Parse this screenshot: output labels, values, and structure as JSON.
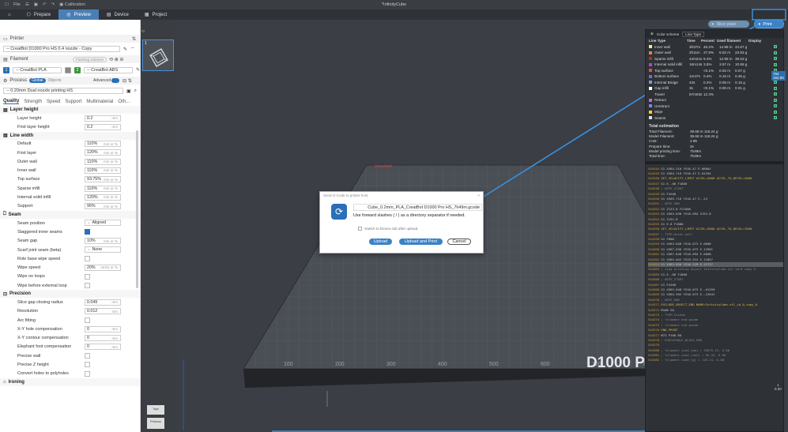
{
  "titlebar": {
    "items": [
      "File"
    ],
    "title": "*InfinityCube"
  },
  "tabs": [
    {
      "label": "Prepare",
      "active": false
    },
    {
      "label": "Preview",
      "active": true
    },
    {
      "label": "Device",
      "active": false
    },
    {
      "label": "Project",
      "active": false
    }
  ],
  "topright": {
    "slice_plate": "Slice plate",
    "print": "Print"
  },
  "sidebar": {
    "printer_header": "Printer",
    "printer_value": "-- CreatBot D1000 Pro HS 0.4 nozzle - Copy",
    "filament_header": "Filament",
    "flushing_label": "Flushing volumes",
    "filament_1": "-- CreatBot PLA",
    "filament_2": "-- CreatBot ABS",
    "process_header": "Process",
    "process_global": "Global",
    "process_objects": "Objects",
    "advanced_label": "Advanced",
    "process_value": "-- 0.20mm Dual nozzle printing HS",
    "quality_tabs": [
      "Quality",
      "Strength",
      "Speed",
      "Support",
      "Multimaterial",
      "Oth..."
    ],
    "groups": {
      "layer_height": "Layer height",
      "line_width": "Line width",
      "seam": "Seam",
      "precision": "Precision",
      "ironing": "Ironing"
    },
    "layer_height": [
      {
        "label": "Layer height",
        "value": "0.2",
        "unit": "mm"
      },
      {
        "label": "First layer height",
        "value": "0.2",
        "unit": "mm"
      }
    ],
    "line_width": [
      {
        "label": "Default",
        "value": "110%",
        "unit": "mm or %"
      },
      {
        "label": "First layer",
        "value": "120%",
        "unit": "mm or %"
      },
      {
        "label": "Outer wall",
        "value": "110%",
        "unit": "mm or %"
      },
      {
        "label": "Inner wall",
        "value": "110%",
        "unit": "mm or %"
      },
      {
        "label": "Top surface",
        "value": "93.75%",
        "unit": "mm or %"
      },
      {
        "label": "Sparse infill",
        "value": "110%",
        "unit": "mm or %"
      },
      {
        "label": "Internal solid infill",
        "value": "120%",
        "unit": "mm or %"
      },
      {
        "label": "Support",
        "value": "96%",
        "unit": "mm or %"
      }
    ],
    "seam": [
      {
        "label": "Seam position",
        "value": "Aligned",
        "unit": "",
        "type": "select"
      },
      {
        "label": "Staggered inner seams",
        "value": "",
        "unit": "",
        "type": "check",
        "checked": true
      },
      {
        "label": "Seam gap",
        "value": "10%",
        "unit": "mm or %"
      },
      {
        "label": "Scarf joint seam (beta)",
        "value": "None",
        "unit": "",
        "type": "select"
      },
      {
        "label": "Role base wipe speed",
        "value": "",
        "unit": "",
        "type": "check",
        "checked": false
      },
      {
        "label": "Wipe speed",
        "value": "20%",
        "unit": "mm/s or %"
      },
      {
        "label": "Wipe on loops",
        "value": "",
        "unit": "",
        "type": "check",
        "checked": false
      },
      {
        "label": "Wipe before external loop",
        "value": "",
        "unit": "",
        "type": "check",
        "checked": false
      }
    ],
    "precision": [
      {
        "label": "Slice gap closing radius",
        "value": "0.049",
        "unit": "mm"
      },
      {
        "label": "Resolution",
        "value": "0.012",
        "unit": "mm"
      },
      {
        "label": "Arc fitting",
        "value": "",
        "unit": "",
        "type": "check",
        "checked": false
      },
      {
        "label": "X-Y hole compensation",
        "value": "0",
        "unit": "mm"
      },
      {
        "label": "X-Y contour compensation",
        "value": "0",
        "unit": "mm"
      },
      {
        "label": "Elephant foot compensation",
        "value": "0",
        "unit": "mm"
      },
      {
        "label": "Precise wall",
        "value": "",
        "unit": "",
        "type": "check",
        "checked": false
      },
      {
        "label": "Precise Z height",
        "value": "",
        "unit": "",
        "type": "check",
        "checked": false
      },
      {
        "label": "Convert holes to polyholes",
        "value": "",
        "unit": "",
        "type": "check",
        "checked": false
      }
    ]
  },
  "thumb_index": "1",
  "bed": {
    "brand": "D1000 Pro",
    "ticks": [
      "100",
      "200",
      "300",
      "400",
      "500",
      "600",
      "700",
      "800",
      "900"
    ]
  },
  "legend": {
    "scheme_label": "Color scheme",
    "scheme_value": "Line Type",
    "headers": [
      "Line Type",
      "Time",
      "Percent",
      "Used filament",
      "Display"
    ],
    "rows": [
      {
        "name": "Inner wall",
        "color": "#ffe680",
        "time": "3h37m",
        "pct": "46.2%",
        "len": "14.98 m",
        "wt": "44.67 g"
      },
      {
        "name": "Outer wall",
        "color": "#ff7d38",
        "time": "2h11m",
        "pct": "27.9%",
        "len": "8.02 m",
        "wt": "23.93 g"
      },
      {
        "name": "Sparse infill",
        "color": "#b03029",
        "time": "44m21s",
        "pct": "9.4%",
        "len": "12.95 m",
        "wt": "38.63 g"
      },
      {
        "name": "Internal solid infill",
        "color": "#9654cc",
        "time": "16m14s",
        "pct": "3.5%",
        "len": "3.57 m",
        "wt": "10.65 g"
      },
      {
        "name": "Top surface",
        "color": "#f04848",
        "time": "",
        "pct": "<0.1%",
        "len": "0.02 m",
        "wt": "0.07 g"
      },
      {
        "name": "Bottom surface",
        "color": "#6d6fd0",
        "time": "1m47s",
        "pct": "0.4%",
        "len": "0.15 m",
        "wt": "0.46 g"
      },
      {
        "name": "Internal Bridge",
        "color": "#7a9ae0",
        "time": "43s",
        "pct": "0.2%",
        "len": "0.05 m",
        "wt": "0.15 g"
      },
      {
        "name": "Gap infill",
        "color": "#ffffff",
        "time": "3s",
        "pct": "<0.1%",
        "len": "0.00 m",
        "wt": "0.01 g"
      },
      {
        "name": "Travel",
        "color": "",
        "time": "57m03s",
        "pct": "12.3%",
        "len": "",
        "wt": ""
      },
      {
        "name": "Retract",
        "color": "#e05cc8",
        "time": "",
        "pct": "",
        "len": "",
        "wt": ""
      },
      {
        "name": "Unretract",
        "color": "#6a8cf0",
        "time": "",
        "pct": "",
        "len": "",
        "wt": ""
      },
      {
        "name": "Wipe",
        "color": "#ffd400",
        "time": "",
        "pct": "",
        "len": "",
        "wt": ""
      },
      {
        "name": "Seams",
        "color": "#e0e0e0",
        "time": "",
        "pct": "",
        "len": "",
        "wt": ""
      }
    ],
    "total_title": "Total estimation",
    "totals": [
      {
        "label": "Total Filament:",
        "value": "39.68 m    118.24 g"
      },
      {
        "label": "Model Filament:",
        "value": "39.68 m    118.24 g"
      },
      {
        "label": "Cost:",
        "value": "2.95"
      },
      {
        "label": "Prepare time:",
        "value": "2s"
      },
      {
        "label": "Model printing time:",
        "value": "7h49m"
      },
      {
        "label": "Total time:",
        "value": "7h49m"
      }
    ],
    "gcode": [
      {
        "n": "544344",
        "t": "G1 X564.316 Y516.47 E.08001"
      },
      {
        "n": "544345",
        "t": "G1 X564.716 Y516.47 E.01294"
      },
      {
        "n": "544346",
        "t": "SET_VELOCITY_LIMIT ACCEL=4000 ACCEL_TO_DECEL=2000"
      },
      {
        "n": "544347",
        "t": "G1 E-.06 F1800"
      },
      {
        "n": "544348",
        "t": "; WIPE_START"
      },
      {
        "n": "544349",
        "t": "G1 F4200"
      },
      {
        "n": "544350",
        "t": "G1 X565.716 Y516.47 E-.24"
      },
      {
        "n": "544351",
        "t": "; WIPE_END"
      },
      {
        "n": "544352",
        "t": "G1 Z153.8 F21000"
      },
      {
        "n": "544353",
        "t": "G1 X563.636 Y516.094 Z153.8"
      },
      {
        "n": "544354",
        "t": "G1 Z152.8"
      },
      {
        "n": "544355",
        "t": "G1 E.8 F1800"
      },
      {
        "n": "544356",
        "t": "SET_VELOCITY_LIMIT ACCEL=3000 ACCEL_TO_DECEL=1500"
      },
      {
        "n": "544357",
        "t": "; TYPE:Outer wall"
      },
      {
        "n": "544358",
        "t": "G1 F600"
      },
      {
        "n": "544359",
        "t": "G1 X563.648 Y516.073 E.0008"
      },
      {
        "n": "544360",
        "t": "G1 X567.636 Y516.073 E.12901"
      },
      {
        "n": "544361",
        "t": "G1 X567.648 Y516.094 E.0008"
      },
      {
        "n": "544362",
        "t": "G1 X565.642 Y519.524 E.12857"
      },
      {
        "n": "544363",
        "t": "G1 X563.656 Y516.129 E.12727"
      },
      {
        "n": "544364",
        "t": "; stop printing object InfinityCube.stl id:0 copy 0"
      },
      {
        "n": "544365",
        "t": "G1 E-.06 F1800"
      },
      {
        "n": "544366",
        "t": "; WIPE_START"
      },
      {
        "n": "544367",
        "t": "G1 F4200"
      },
      {
        "n": "544368",
        "t": "G1 X563.648 Y516.073 E-.01359"
      },
      {
        "n": "544369",
        "t": "G1 X564.592 Y516.073 E-.22641"
      },
      {
        "n": "544370",
        "t": "; WIPE_END"
      },
      {
        "n": "544371",
        "t": "EXCLUDE_OBJECT_END NAME=InfinityCube.stl_id_0_copy_0"
      },
      {
        "n": "544372",
        "t": "M106 S0"
      },
      {
        "n": "544373",
        "t": "; TYPE:Custom"
      },
      {
        "n": "544374",
        "t": "; filament end gcode"
      },
      {
        "n": "544375",
        "t": "; filament end gcode"
      },
      {
        "n": "544376",
        "t": "END_PRINT"
      },
      {
        "n": "544377",
        "t": "M73 P100 R0"
      },
      {
        "n": "544378",
        "t": "; EXECUTABLE_BLOCK_END"
      },
      {
        "n": "544379",
        "t": ""
      },
      {
        "n": "544380",
        "t": "; filament used [mm] = 39675.15, 0.00"
      },
      {
        "n": "544381",
        "t": "; filament used [cm3] = 95.43, 0.00"
      },
      {
        "n": "544382",
        "t": "; filament used [g] = 118.24, 0.00"
      }
    ]
  },
  "layer_top": {
    "layer": "764",
    "height": "152.80"
  },
  "layer_bottom": {
    "layer": "1",
    "height": "0.20"
  },
  "move_value": "43",
  "dialog": {
    "title": "Send G-Code to printer host",
    "filename": "Cube_0.2mm_PLA_CreatBot D1000 Pro HS_7h49m.gcode",
    "hint": "Use forward slashes ( / ) as a directory separator if needed.",
    "switch_label": "Switch to Device tab after upload.",
    "upload": "Upload",
    "upload_print": "Upload and Print",
    "cancel": "Cancel"
  },
  "viewbtns": [
    "Tops",
    "Previous"
  ]
}
